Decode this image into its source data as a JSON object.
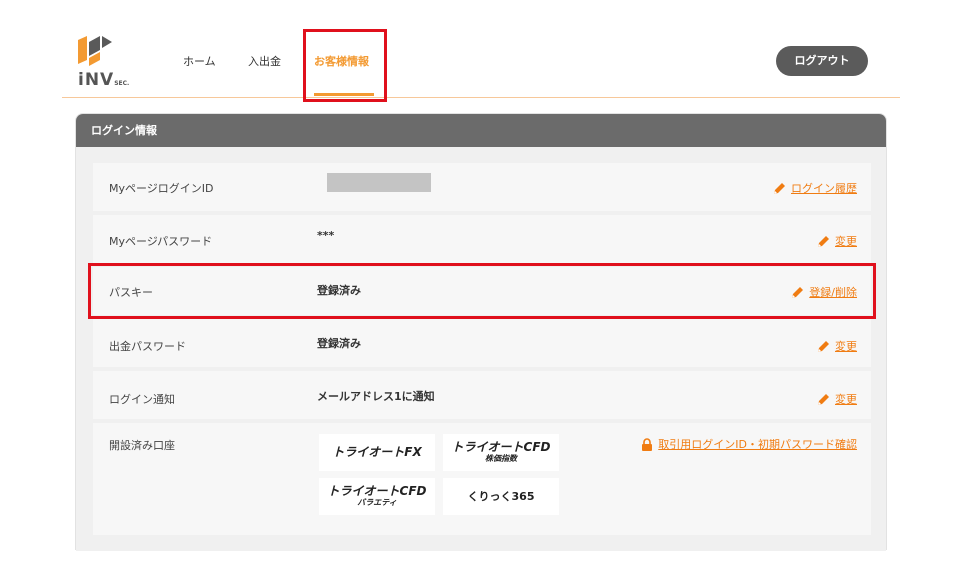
{
  "header": {
    "logo_text": "iNV",
    "logo_sub": "SEC.",
    "nav": [
      "ホーム",
      "入出金",
      "お客様情報"
    ],
    "active_nav": "お客様情報",
    "logout_label": "ログアウト"
  },
  "panel": {
    "title": "ログイン情報",
    "rows": [
      {
        "label": "MyページログインID",
        "value": "",
        "action": "ログイン履歴",
        "action_icon": "pencil-icon"
      },
      {
        "label": "Myページパスワード",
        "value": "***",
        "action": "変更",
        "action_icon": "pencil-icon"
      },
      {
        "label": "パスキー",
        "value": "登録済み",
        "action": "登録/削除",
        "action_icon": "pencil-icon"
      },
      {
        "label": "出金パスワード",
        "value": "登録済み",
        "action": "変更",
        "action_icon": "pencil-icon"
      },
      {
        "label": "ログイン通知",
        "value": "メールアドレス1に通知",
        "action": "変更",
        "action_icon": "pencil-icon"
      },
      {
        "label": "開設済み口座",
        "action": "取引用ログインID・初期パスワード確認",
        "action_icon": "lock-icon"
      }
    ],
    "accounts": [
      {
        "line1": "トライオートFX",
        "line2": ""
      },
      {
        "line1": "トライオートCFD",
        "line2": "株価指数"
      },
      {
        "line1": "トライオートCFD",
        "line2": "バラエティ"
      },
      {
        "line1": "くりっく365",
        "line2": ""
      }
    ]
  },
  "colors": {
    "accent": "#f39a32",
    "link": "#f07c12",
    "header_bar": "#6b6b6b",
    "highlight": "#e0101c",
    "logout_bg": "#5b5b5b"
  }
}
